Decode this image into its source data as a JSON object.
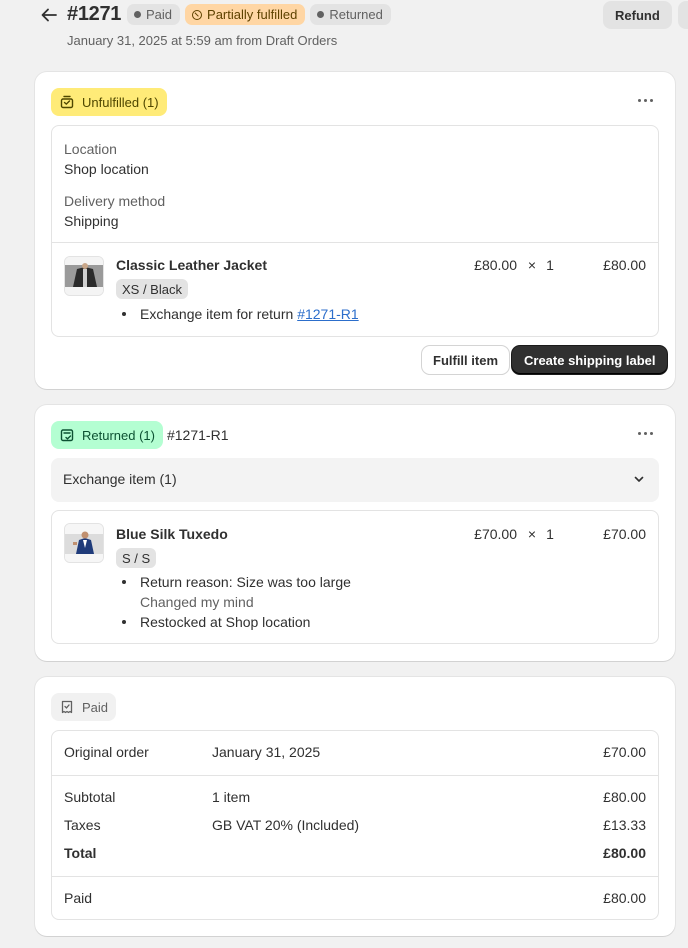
{
  "header": {
    "order_number": "#1271",
    "badges": [
      "Paid",
      "Partially fulfilled",
      "Returned"
    ],
    "subtitle": "January 31, 2025 at 5:59 am from Draft Orders",
    "refund_label": "Refund"
  },
  "unfulfilled": {
    "status": "Unfulfilled (1)",
    "location_label": "Location",
    "location_value": "Shop location",
    "delivery_label": "Delivery method",
    "delivery_value": "Shipping",
    "item": {
      "name": "Classic Leather Jacket",
      "variant": "XS / Black",
      "unit_price": "£80.00",
      "times": "×",
      "quantity": "1",
      "total": "£80.00",
      "note": "Exchange item for return",
      "return_link": "#1271-R1"
    },
    "fulfill_label": "Fulfill item",
    "shipping_label": "Create shipping label"
  },
  "returned": {
    "status": "Returned (1)",
    "return_id": "#1271-R1",
    "accordion_label": "Exchange item (1)",
    "item": {
      "name": "Blue Silk Tuxedo",
      "variant": "S / S",
      "unit_price": "£70.00",
      "times": "×",
      "quantity": "1",
      "total": "£70.00",
      "reason": "Return reason: Size was too large",
      "reason_note": "Changed my mind",
      "restock": "Restocked at Shop location"
    }
  },
  "payment": {
    "status": "Paid",
    "original_order": {
      "label": "Original order",
      "date": "January 31, 2025",
      "amount": "£70.00"
    },
    "subtotal": {
      "label": "Subtotal",
      "detail": "1 item",
      "amount": "£80.00"
    },
    "taxes": {
      "label": "Taxes",
      "detail": "GB VAT 20% (Included)",
      "amount": "£13.33"
    },
    "total": {
      "label": "Total",
      "amount": "£80.00"
    },
    "paid": {
      "label": "Paid",
      "amount": "£80.00"
    }
  },
  "colors": {
    "unfulfilled_chip": "#ffeb78",
    "returned_chip": "#b4fed2",
    "partial_badge": "#ffd6a4",
    "link": "#2c6ecb",
    "primary_button": "#303030"
  }
}
